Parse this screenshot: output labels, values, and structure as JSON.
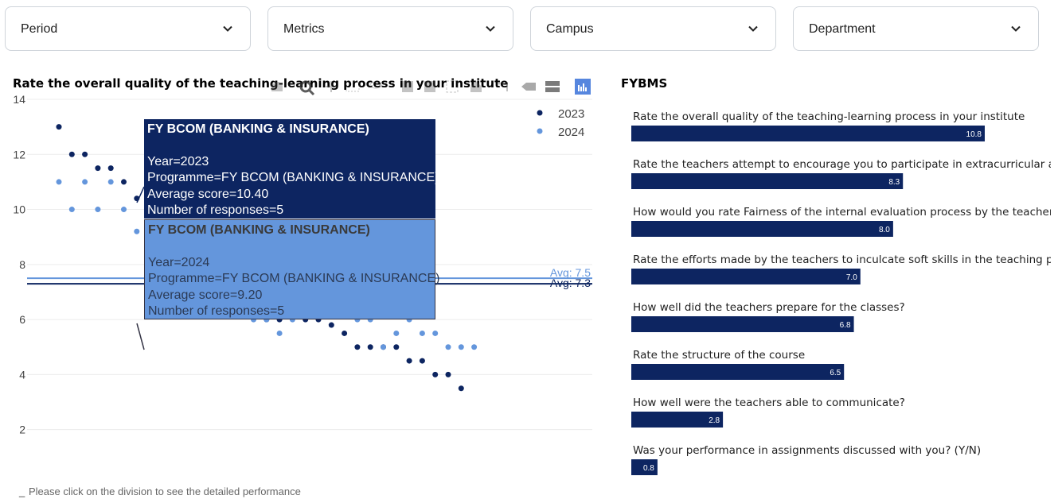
{
  "filters": [
    {
      "label": "Period"
    },
    {
      "label": "Metrics"
    },
    {
      "label": "Campus"
    },
    {
      "label": "Department"
    }
  ],
  "left": {
    "title": "Rate the overall quality of the teaching-learning process in your institute",
    "footer_note": "Please click on the division to see the detailed performance",
    "footer_dash": "_",
    "tooltip_2023": {
      "header": "FY BCOM (BANKING & INSURANCE)",
      "year": "Year=2023",
      "programme": "Programme=FY BCOM (BANKING & INSURANCE)",
      "avg": "Average score=10.40",
      "responses": "Number of responses=5"
    },
    "tooltip_2024": {
      "header": "FY BCOM (BANKING & INSURANCE)",
      "year": "Year=2024",
      "programme": "Programme=FY BCOM (BANKING & INSURANCE)",
      "avg": "Average score=9.20",
      "responses": "Number of responses=5"
    }
  },
  "right": {
    "title": "FYBMS"
  },
  "colors": {
    "series_2023": "#0d2561",
    "series_2024": "#6496dc",
    "bar": "#0d2561",
    "grid": "#ececec"
  },
  "chart_data": [
    {
      "type": "scatter",
      "title": "Rate the overall quality of the teaching-learning process in your institute",
      "ylim": [
        1.5,
        14
      ],
      "yticks": [
        2,
        4,
        6,
        8,
        10,
        12,
        14
      ],
      "grid": true,
      "legend_position": "top-right",
      "series": [
        {
          "name": "2023",
          "color": "#0d2561",
          "values": [
            13,
            12,
            12,
            11.5,
            11.5,
            11,
            10.4,
            10,
            10,
            10,
            9.5,
            9.5,
            8,
            7.5,
            7,
            6.5,
            6,
            6,
            6.3,
            6,
            6,
            5.8,
            5.5,
            5,
            5,
            5,
            5,
            4.5,
            4.5,
            4,
            4,
            3.5
          ]
        },
        {
          "name": "2024",
          "color": "#6496dc",
          "values": [
            11,
            10,
            11,
            10,
            11,
            10,
            9.2,
            9,
            8.5,
            8,
            8,
            7.5,
            7.5,
            6.5,
            6.5,
            6,
            6,
            5.5,
            6,
            6.3,
            6.4,
            6.6,
            6.4,
            6,
            6,
            5,
            5.5,
            6,
            5.5,
            5.5,
            5,
            5,
            5
          ]
        }
      ],
      "reference_lines": [
        {
          "label": "Avg: 7.5",
          "value": 7.5,
          "color": "#6496dc"
        },
        {
          "label": "Avg: 7.3",
          "value": 7.3,
          "color": "#0d2561"
        }
      ]
    },
    {
      "type": "bar",
      "orientation": "horizontal",
      "categories": [
        "Rate the overall quality of the teaching-learning process in your institute",
        "Rate the teachers attempt to encourage you to participate in extracurricular activities",
        "How would you rate Fairness of the internal evaluation process by the teachers?",
        "Rate the efforts made by the teachers to inculcate soft skills in the teaching process",
        "How well did the teachers prepare for the classes?",
        "Rate the structure of the course",
        "How well were the teachers able to communicate?",
        "Was your performance in assignments discussed with you? (Y/N)"
      ],
      "values": [
        10.8,
        8.3,
        8.0,
        7.0,
        6.8,
        6.5,
        2.8,
        0.8
      ],
      "labels": [
        "10.8",
        "8.3",
        "8.0",
        "7.0",
        "6.8",
        "6.5",
        "2.8",
        "0.8"
      ],
      "xlim": [
        0,
        14
      ]
    }
  ]
}
